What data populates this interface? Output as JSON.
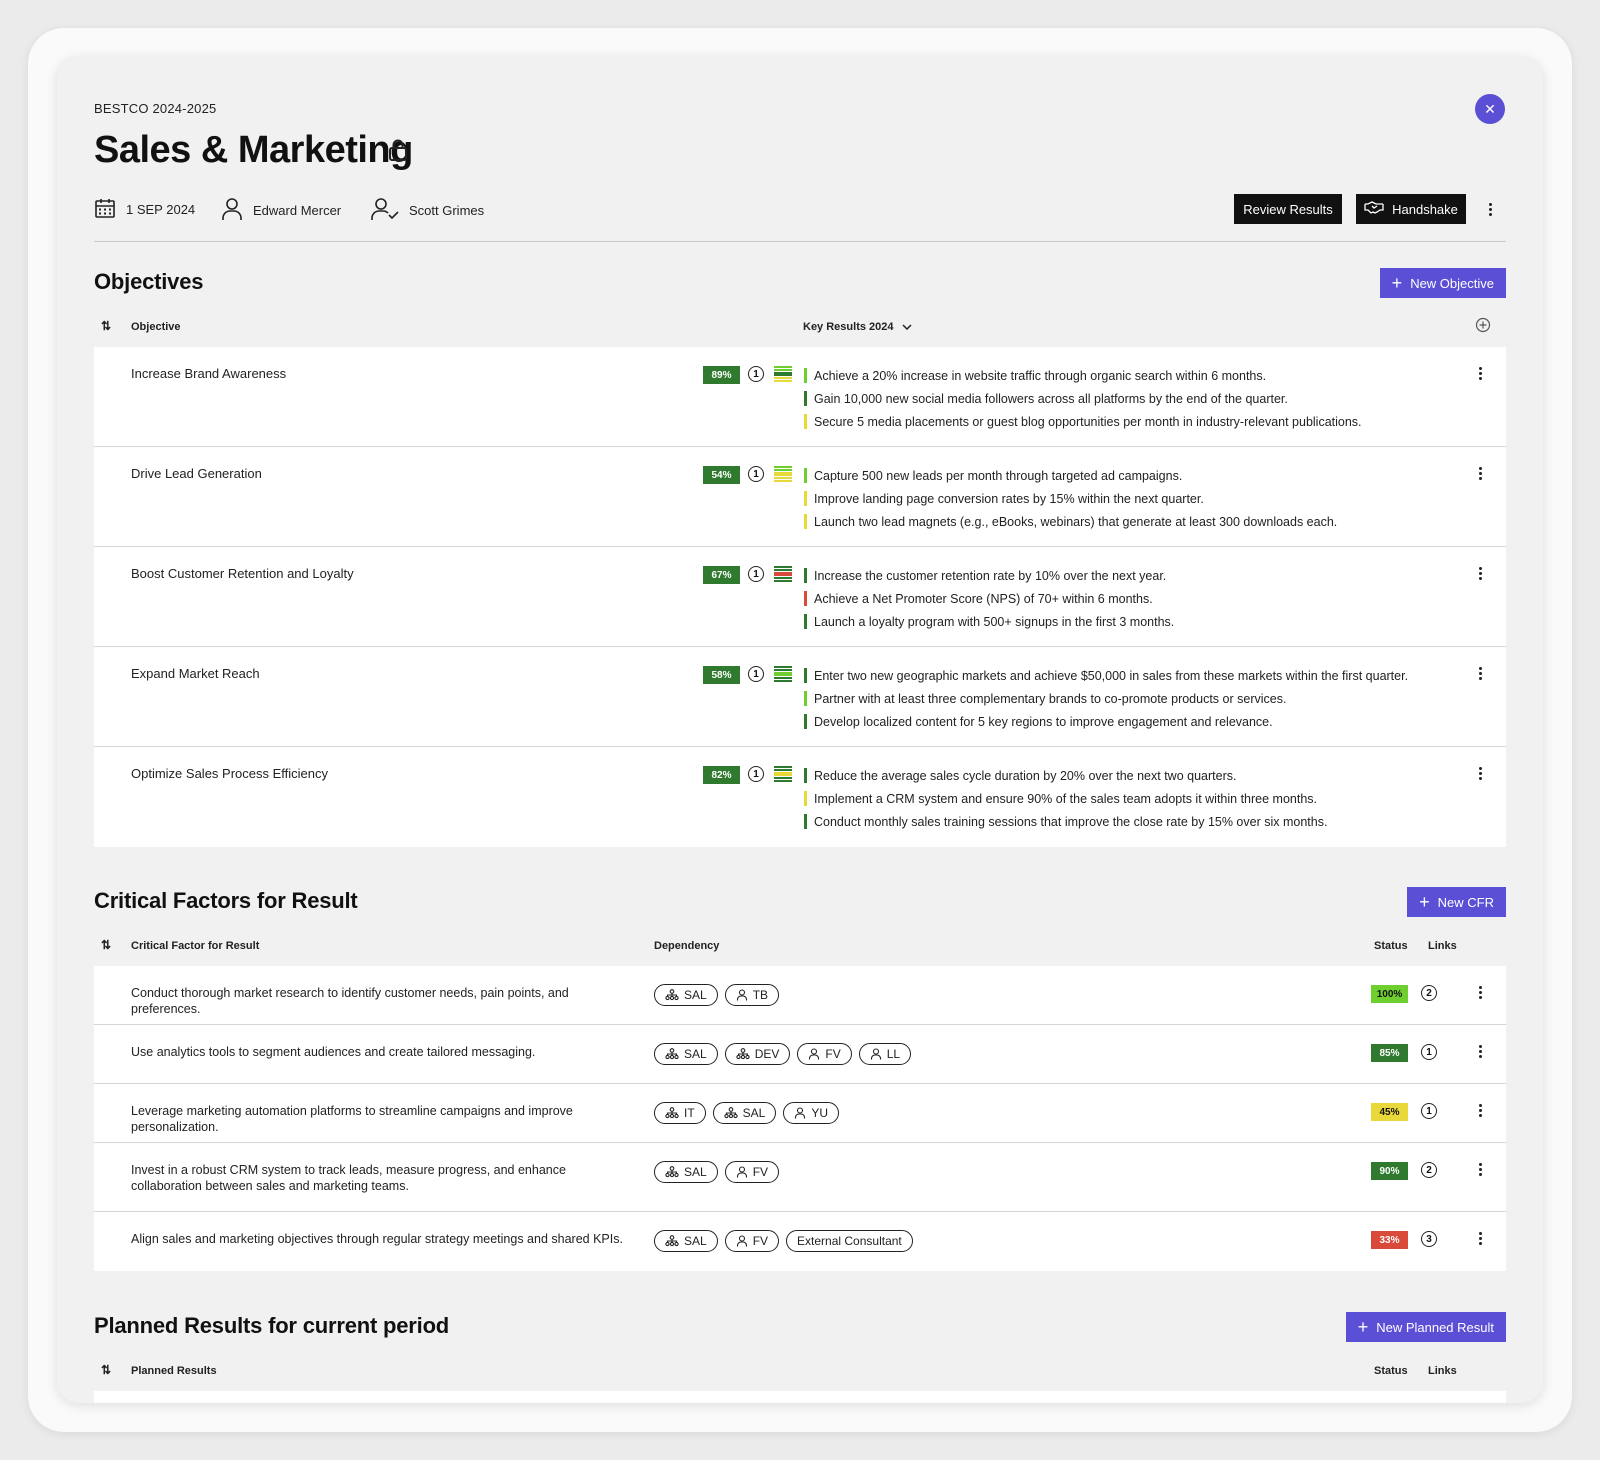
{
  "header": {
    "eyebrow": "BESTCO 2024-2025",
    "title": "Sales & Marketing",
    "date": "1 SEP 2024",
    "owner": "Edward Mercer",
    "reviewer": "Scott Grimes",
    "review_label": "Review Results",
    "handshake_label": "Handshake"
  },
  "objectives": {
    "title": "Objectives",
    "new_label": "New Objective",
    "col_objective": "Objective",
    "col_key_results": "Key Results 2024",
    "rows": [
      {
        "name": "Increase Brand Awareness",
        "pct": "89%",
        "count": "1",
        "status_colors": [
          "#6fcf2f",
          "#2f7a2f",
          "#e8d83a"
        ],
        "krs": [
          {
            "text": "Achieve a 20% increase in website traffic through organic search within 6 months.",
            "color": "#6fcf2f"
          },
          {
            "text": "Gain 10,000 new social media followers across all platforms by the end of the quarter.",
            "color": "#2f7a2f"
          },
          {
            "text": "Secure 5 media placements or guest blog opportunities per month in industry-relevant publications.",
            "color": "#e8d83a"
          }
        ]
      },
      {
        "name": "Drive Lead Generation",
        "pct": "54%",
        "count": "1",
        "status_colors": [
          "#6fcf2f",
          "#e8d83a",
          "#e8d83a"
        ],
        "krs": [
          {
            "text": "Capture 500 new leads per month through targeted ad campaigns.",
            "color": "#6fcf2f"
          },
          {
            "text": "Improve landing page conversion rates by 15% within the next quarter.",
            "color": "#e8d83a"
          },
          {
            "text": "Launch two lead magnets (e.g., eBooks, webinars) that generate at least 300 downloads each.",
            "color": "#e8d83a"
          }
        ]
      },
      {
        "name": "Boost Customer Retention and Loyalty",
        "pct": "67%",
        "count": "1",
        "status_colors": [
          "#2f7a2f",
          "#d94a3a",
          "#2f7a2f"
        ],
        "krs": [
          {
            "text": "Increase the customer retention rate by 10% over the next year.",
            "color": "#2f7a2f"
          },
          {
            "text": "Achieve a Net Promoter Score (NPS) of 70+ within 6 months.",
            "color": "#d94a3a"
          },
          {
            "text": "Launch a loyalty program with 500+ signups in the first 3 months.",
            "color": "#2f7a2f"
          }
        ]
      },
      {
        "name": "Expand Market Reach",
        "pct": "58%",
        "count": "1",
        "status_colors": [
          "#2f7a2f",
          "#6fcf2f",
          "#2f7a2f"
        ],
        "krs": [
          {
            "text": "Enter two new geographic markets and achieve $50,000 in sales from these markets within the first quarter.",
            "color": "#2f7a2f"
          },
          {
            "text": "Partner with at least three complementary brands to co-promote products or services.",
            "color": "#6fcf2f"
          },
          {
            "text": "Develop localized content for 5 key regions to improve engagement and relevance.",
            "color": "#2f7a2f"
          }
        ]
      },
      {
        "name": "Optimize Sales Process Efficiency",
        "pct": "82%",
        "count": "1",
        "status_colors": [
          "#2f7a2f",
          "#e8d83a",
          "#2f7a2f"
        ],
        "krs": [
          {
            "text": "Reduce the average sales cycle duration by 20% over the next two quarters.",
            "color": "#2f7a2f"
          },
          {
            "text": "Implement a CRM system and ensure 90% of the sales team adopts it within three months.",
            "color": "#e8d83a"
          },
          {
            "text": "Conduct monthly sales training sessions that improve the close rate by 15% over six months.",
            "color": "#2f7a2f"
          }
        ]
      }
    ]
  },
  "cfr": {
    "title": "Critical Factors for Result",
    "new_label": "New CFR",
    "col_factor": "Critical Factor for Result",
    "col_dependency": "Dependency",
    "col_status": "Status",
    "col_links": "Links",
    "rows": [
      {
        "text": "Conduct thorough market research to identify customer needs, pain points, and preferences.",
        "deps": [
          {
            "label": "SAL",
            "icon": "team-icon"
          },
          {
            "label": "TB",
            "icon": "person-icon"
          }
        ],
        "status": "100%",
        "status_bg": "#6fcf2f",
        "status_fg": "#111",
        "links": "2"
      },
      {
        "text": "Use analytics tools to segment audiences and create tailored messaging.",
        "deps": [
          {
            "label": "SAL",
            "icon": "team-icon"
          },
          {
            "label": "DEV",
            "icon": "team-icon"
          },
          {
            "label": "FV",
            "icon": "person-icon"
          },
          {
            "label": "LL",
            "icon": "person-icon"
          }
        ],
        "status": "85%",
        "status_bg": "#2f7a2f",
        "status_fg": "#fff",
        "links": "1"
      },
      {
        "text": "Leverage marketing automation platforms to streamline campaigns and improve personalization.",
        "deps": [
          {
            "label": "IT",
            "icon": "team-icon"
          },
          {
            "label": "SAL",
            "icon": "team-icon"
          },
          {
            "label": "YU",
            "icon": "person-icon"
          }
        ],
        "status": "45%",
        "status_bg": "#e8d83a",
        "status_fg": "#111",
        "links": "1"
      },
      {
        "text": "Invest in a robust CRM system to track leads, measure progress, and enhance collaboration between sales and marketing teams.",
        "deps": [
          {
            "label": "SAL",
            "icon": "team-icon"
          },
          {
            "label": "FV",
            "icon": "person-icon"
          }
        ],
        "status": "90%",
        "status_bg": "#2f7a2f",
        "status_fg": "#fff",
        "links": "2"
      },
      {
        "text": "Align sales and marketing objectives through regular strategy meetings and shared KPIs.",
        "deps": [
          {
            "label": "SAL",
            "icon": "team-icon"
          },
          {
            "label": "FV",
            "icon": "person-icon"
          },
          {
            "label": "External Consultant",
            "icon": ""
          }
        ],
        "status": "33%",
        "status_bg": "#d94a3a",
        "status_fg": "#fff",
        "links": "3"
      }
    ]
  },
  "planned": {
    "title": "Planned Results for current period",
    "new_label": "New Planned Result",
    "col_results": "Planned Results",
    "col_status": "Status",
    "col_links": "Links"
  },
  "colors": {
    "accent": "#5b4fd6",
    "dark_green": "#2f7a2f",
    "light_green": "#6fcf2f",
    "yellow": "#e8d83a",
    "red": "#d94a3a"
  }
}
